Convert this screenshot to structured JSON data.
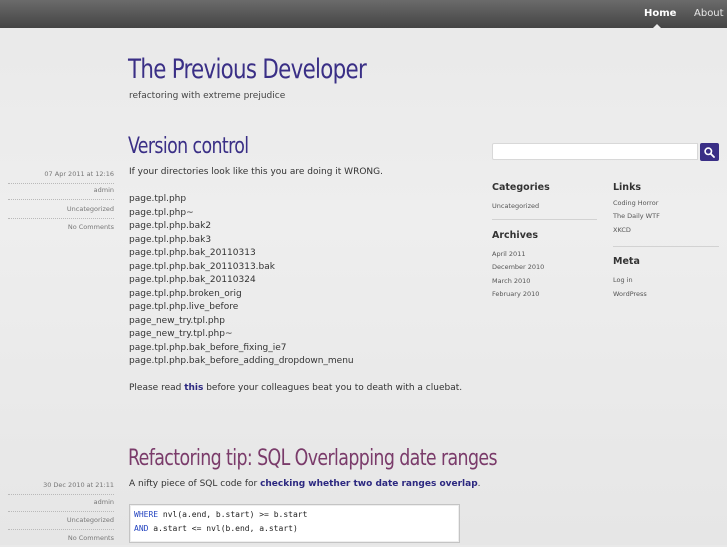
{
  "nav": {
    "home": "Home",
    "about": "About"
  },
  "site": {
    "title": "The Previous Developer",
    "tagline": "refactoring with extreme prejudice"
  },
  "post1": {
    "title": "Version control",
    "date": "07 Apr 2011 at 12:16",
    "author": "admin",
    "category": "Uncategorized",
    "comments": "No Comments",
    "intro": "If your directories look like this you are doing it WRONG.",
    "files": [
      "page.tpl.php",
      "page.tpl.php~",
      "page.tpl.php.bak2",
      "page.tpl.php.bak3",
      "page.tpl.php.bak_20110313",
      "page.tpl.php.bak_20110313.bak",
      "page.tpl.php.bak_20110324",
      "page.tpl.php.broken_orig",
      "page.tpl.php.live_before",
      "page_new_try.tpl.php",
      "page_new_try.tpl.php~",
      "page.tpl.php.bak_before_fixing_ie7",
      "page.tpl.php.bak_before_adding_dropdown_menu"
    ],
    "outro_before": "Please read ",
    "outro_link": "this",
    "outro_after": " before your colleagues beat you to death with a cluebat."
  },
  "post2": {
    "title": "Refactoring tip: SQL Overlapping date ranges",
    "date": "30 Dec 2010 at 21:11",
    "author": "admin",
    "category": "Uncategorized",
    "comments": "No Comments",
    "intro_before": "A nifty piece of SQL code for ",
    "intro_link": "checking whether two date ranges overlap",
    "intro_after": ".",
    "code": [
      {
        "kw": "WHERE",
        "rest": " nvl(a.end, b.start) >= b.start"
      },
      {
        "kw": "AND",
        "rest": " a.start <= nvl(b.end, a.start)"
      }
    ]
  },
  "sidebar": {
    "categories": {
      "title": "Categories",
      "items": [
        "Uncategorized"
      ]
    },
    "archives": {
      "title": "Archives",
      "items": [
        "April 2011",
        "December 2010",
        "March 2010",
        "February 2010"
      ]
    },
    "links": {
      "title": "Links",
      "items": [
        "Coding Horror",
        "The Daily WTF",
        "XKCD"
      ]
    },
    "meta": {
      "title": "Meta",
      "items": [
        "Log in",
        "WordPress"
      ]
    }
  },
  "colors": {
    "accent": "#3a2f86",
    "post_title_alt": "#7a3b6a"
  },
  "icons": {
    "search": "search-icon"
  }
}
